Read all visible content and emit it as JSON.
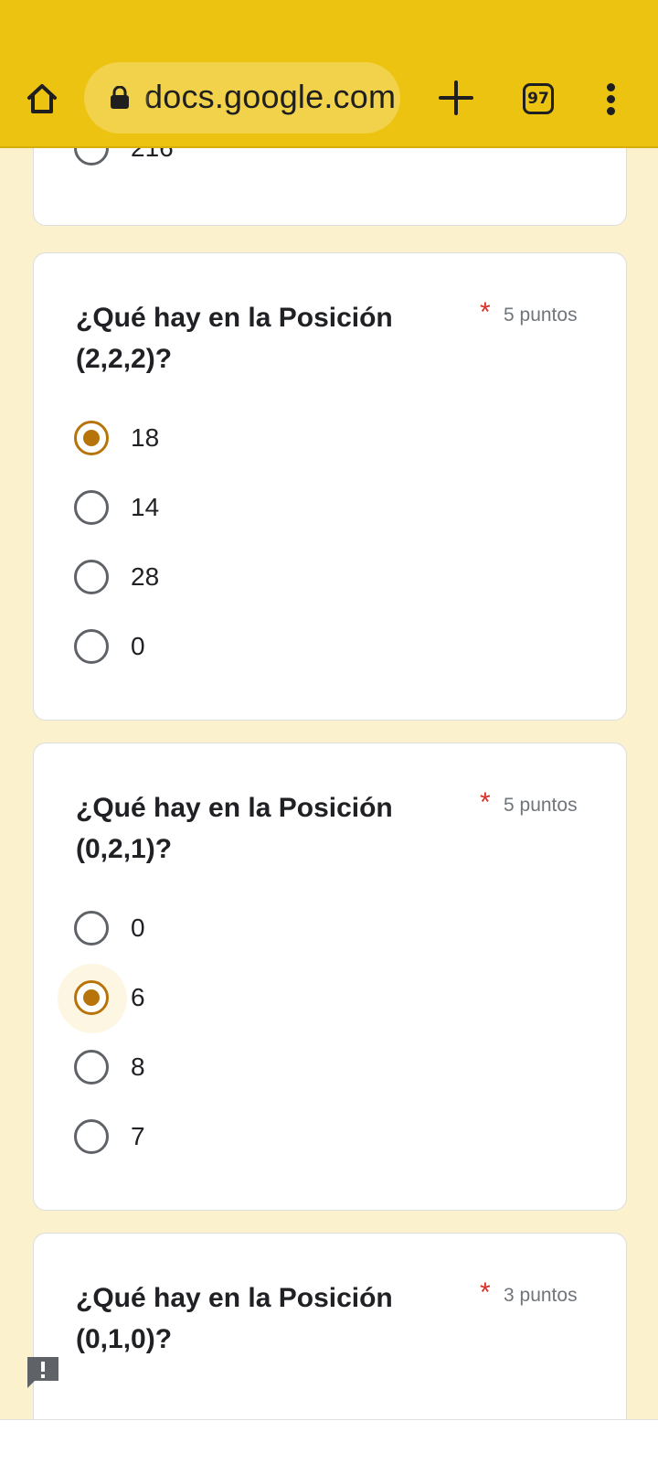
{
  "browser": {
    "url": "docs.google.com",
    "tab_count": "97",
    "icons": {
      "home": "home-icon",
      "lock": "lock-icon",
      "new_tab": "plus-icon",
      "menu": "more-vert-icon"
    },
    "bar_color": "#ecc311"
  },
  "form": {
    "accent_color": "#b7740a",
    "previous_card": {
      "last_option_label": "216"
    },
    "questions": [
      {
        "title": "¿Qué hay en la Posición (2,2,2)?",
        "required_mark": "*",
        "points": "5 puntos",
        "options": [
          "18",
          "14",
          "28",
          "0"
        ],
        "selected_index": 0
      },
      {
        "title": "¿Qué hay en la  Posición (0,2,1)?",
        "required_mark": "*",
        "points": "5 puntos",
        "options": [
          "0",
          "6",
          "8",
          "7"
        ],
        "selected_index": 1
      },
      {
        "title": "¿Qué hay en la  Posición (0,1,0)?",
        "required_mark": "*",
        "points": "3 puntos",
        "options": [],
        "selected_index": null
      }
    ]
  },
  "feedback": {
    "icon": "feedback-icon"
  }
}
